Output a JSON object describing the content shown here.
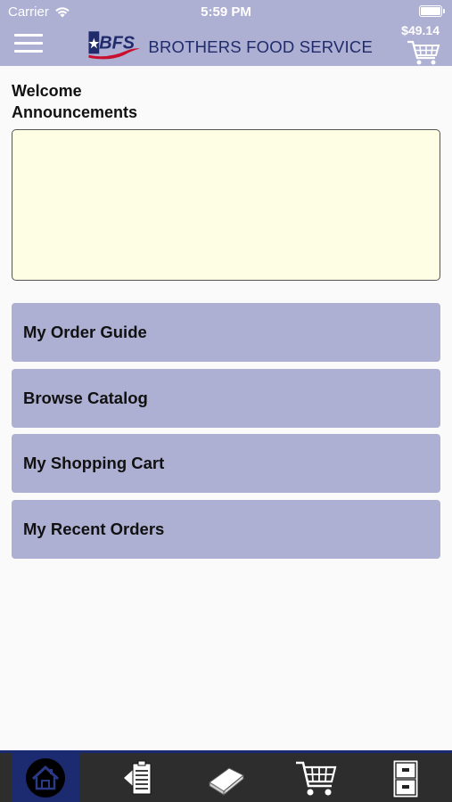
{
  "status_bar": {
    "carrier": "Carrier",
    "time": "5:59 PM"
  },
  "header": {
    "logo_text": "BFS",
    "brand_name": "BROTHERS FOOD SERVICE",
    "cart_total": "$49.14",
    "menu_icon": "hamburger-menu-icon",
    "cart_icon": "shopping-cart-icon"
  },
  "main": {
    "welcome": "Welcome",
    "announcements_label": "Announcements",
    "menu_items": [
      {
        "label": "My Order Guide"
      },
      {
        "label": "Browse Catalog"
      },
      {
        "label": "My Shopping Cart"
      },
      {
        "label": "My Recent Orders"
      }
    ]
  },
  "tab_bar": {
    "tabs": [
      {
        "icon": "home-icon",
        "active": true
      },
      {
        "icon": "order-guide-icon",
        "active": false
      },
      {
        "icon": "catalog-book-icon",
        "active": false
      },
      {
        "icon": "cart-icon",
        "active": false
      },
      {
        "icon": "cabinet-icon",
        "active": false
      }
    ]
  },
  "colors": {
    "accent": "#adafd3",
    "brand_navy": "#1f2b6b",
    "brand_red": "#c8102e",
    "announcement_bg": "#fefee4",
    "tab_bar_bg": "#2d2d2d",
    "tab_active": "#1c2b70"
  }
}
